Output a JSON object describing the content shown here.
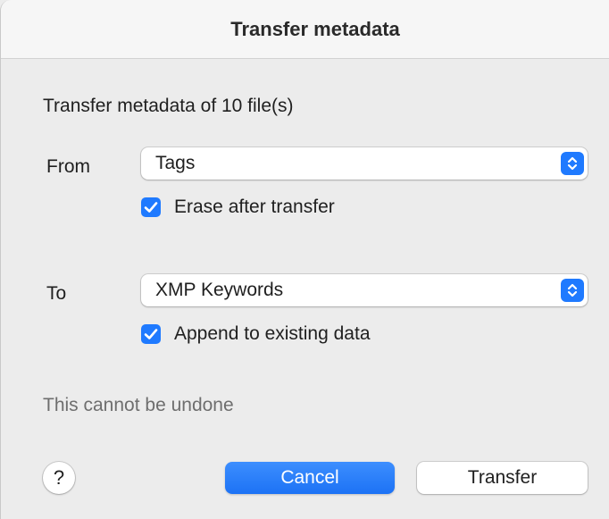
{
  "dialog": {
    "title": "Transfer metadata",
    "description": "Transfer metadata of 10 file(s)",
    "warning": "This cannot be undone"
  },
  "from": {
    "label": "From",
    "selected": "Tags",
    "checkbox": {
      "label": "Erase after transfer",
      "checked": true
    }
  },
  "to": {
    "label": "To",
    "selected": "XMP Keywords",
    "checkbox": {
      "label": "Append to existing data",
      "checked": true
    }
  },
  "buttons": {
    "help": "?",
    "cancel": "Cancel",
    "transfer": "Transfer"
  },
  "colors": {
    "accent": "#1f7aff",
    "background": "#ececec",
    "titlebar": "#f6f6f6"
  },
  "icons": {
    "select_stepper": "chevron-up-down-icon",
    "checkbox": "checkmark-icon"
  }
}
